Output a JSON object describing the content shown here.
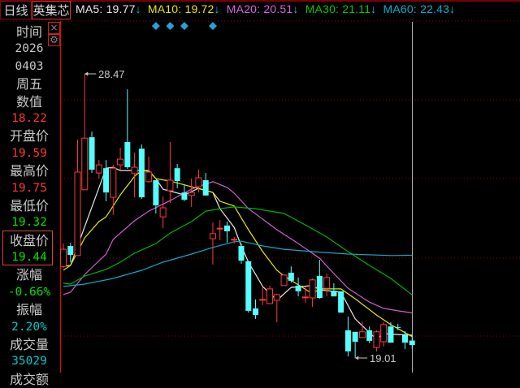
{
  "header": {
    "period": "日线",
    "stock_name": "英集芯",
    "ma_items": [
      {
        "label": "MA5: 19.77",
        "arrow": "↓",
        "color": "#e8e8e8"
      },
      {
        "label": "MA10: 19.72",
        "arrow": "↓",
        "color": "#e8e800"
      },
      {
        "label": "MA20: 20.51",
        "arrow": "↓",
        "color": "#e060e0"
      },
      {
        "label": "MA30: 21.11",
        "arrow": "↓",
        "color": "#00c800"
      },
      {
        "label": "MA60: 22.43",
        "arrow": "↓",
        "color": "#00b0d0"
      }
    ]
  },
  "tools": {
    "close_icon": "×",
    "settings_icon": "⚙"
  },
  "info_panel": {
    "time_label": "时间",
    "year": "2026",
    "date": "0403",
    "weekday": "周五",
    "value_label": "数值",
    "value": "18.22",
    "open_label": "开盘价",
    "open": "19.59",
    "high_label": "最高价",
    "high": "19.75",
    "low_label": "最低价",
    "low": "19.32",
    "close_label": "收盘价",
    "close": "19.44",
    "change_label": "涨幅",
    "change": "-0.66%",
    "amplitude_label": "振幅",
    "amplitude": "2.20%",
    "volume_label": "成交量",
    "volume": "35029",
    "amount_label": "成交额"
  },
  "chart_data": {
    "type": "candlestick",
    "title": "英集芯 日线",
    "max_label": "28.47",
    "min_label": "19.01",
    "colors": {
      "up": "#ff3a3a",
      "down": "#54ffff",
      "grid": "#8a0000"
    },
    "candles": [
      [
        22.06,
        22.82,
        22.01,
        22.63
      ],
      [
        22.74,
        22.85,
        22.2,
        22.44
      ],
      [
        22.42,
        26.28,
        22.42,
        25.2
      ],
      [
        24.61,
        28.47,
        24.61,
        26.33
      ],
      [
        26.36,
        26.55,
        25.17,
        25.28
      ],
      [
        25.17,
        25.6,
        24.98,
        25.44
      ],
      [
        25.33,
        25.6,
        24.23,
        24.52
      ],
      [
        24.36,
        25.44,
        23.77,
        25.33
      ],
      [
        25.44,
        26.01,
        25.25,
        25.63
      ],
      [
        26.2,
        27.96,
        25.31,
        25.36
      ],
      [
        25.15,
        25.85,
        24.36,
        25.36
      ],
      [
        25.98,
        26.12,
        24.31,
        24.36
      ],
      [
        24.88,
        25.71,
        24.85,
        25.2
      ],
      [
        24.93,
        24.93,
        23.82,
        24.09
      ],
      [
        23.71,
        24.39,
        23.33,
        24.01
      ],
      [
        24.58,
        26.2,
        24.17,
        24.93
      ],
      [
        25.33,
        25.47,
        24.66,
        24.9
      ],
      [
        24.52,
        24.79,
        24.23,
        24.28
      ],
      [
        24.42,
        24.98,
        24.04,
        24.52
      ],
      [
        24.71,
        25.28,
        24.52,
        25.01
      ],
      [
        24.93,
        25.17,
        24.42,
        24.42
      ],
      [
        22.98,
        23.52,
        22.12,
        23.15
      ],
      [
        23.31,
        23.6,
        22.93,
        23.33
      ],
      [
        23.42,
        23.55,
        22.85,
        23.23
      ],
      [
        22.95,
        23.04,
        22.82,
        22.96
      ],
      [
        22.74,
        22.82,
        22.15,
        22.25
      ],
      [
        22.23,
        22.23,
        20.52,
        20.58
      ],
      [
        20.66,
        20.96,
        20.31,
        20.44
      ],
      [
        20.95,
        21.39,
        20.77,
        20.96
      ],
      [
        20.82,
        21.42,
        20.82,
        21.31
      ],
      [
        20.93,
        21.15,
        20.2,
        21.12
      ],
      [
        21.42,
        21.79,
        21.42,
        21.77
      ],
      [
        21.85,
        22.06,
        21.52,
        21.58
      ],
      [
        21.42,
        21.69,
        21.06,
        21.23
      ],
      [
        21.03,
        21.39,
        20.85,
        21.04
      ],
      [
        21.01,
        21.66,
        20.71,
        21.61
      ],
      [
        21.74,
        22.28,
        20.98,
        21.01
      ],
      [
        21.33,
        21.82,
        21.06,
        21.69
      ],
      [
        21.25,
        21.5,
        21.06,
        21.06
      ],
      [
        21.23,
        21.23,
        20.52,
        20.52
      ],
      [
        19.93,
        20.39,
        19.06,
        19.23
      ],
      [
        19.88,
        19.88,
        19.01,
        19.55
      ],
      [
        19.69,
        20.23,
        19.69,
        19.88
      ],
      [
        19.93,
        20.06,
        19.5,
        19.58
      ],
      [
        19.36,
        19.93,
        19.23,
        19.88
      ],
      [
        19.55,
        20.2,
        19.39,
        20.12
      ],
      [
        20.06,
        20.2,
        19.52,
        19.52
      ],
      [
        20.04,
        20.15,
        19.93,
        20.03
      ],
      [
        19.77,
        19.9,
        19.31,
        19.52
      ],
      [
        19.59,
        19.75,
        19.32,
        19.44
      ]
    ],
    "candle_fields": [
      "open",
      "high",
      "low",
      "close"
    ],
    "moving_averages": [
      {
        "name": "MA5",
        "color": "#e8e8e8",
        "points": [
          [
            1,
            22.06
          ],
          [
            2,
            22.09
          ],
          [
            7,
            25.33
          ],
          [
            8,
            25.36
          ],
          [
            9,
            25.25
          ],
          [
            13,
            25.25
          ],
          [
            14,
            24.98
          ],
          [
            15,
            24.63
          ],
          [
            18,
            24.44
          ],
          [
            20,
            24.66
          ],
          [
            22,
            24.52
          ],
          [
            23,
            23.98
          ],
          [
            25,
            23.36
          ],
          [
            26,
            22.74
          ],
          [
            27,
            22.2
          ],
          [
            29,
            21.39
          ],
          [
            31,
            20.93
          ],
          [
            33,
            21.36
          ],
          [
            36,
            21.42
          ],
          [
            37,
            21.28
          ],
          [
            40,
            21.2
          ],
          [
            42,
            20.31
          ],
          [
            45,
            19.63
          ],
          [
            46,
            19.82
          ],
          [
            48,
            19.79
          ],
          [
            50,
            19.77
          ]
        ]
      },
      {
        "name": "MA10",
        "color": "#e8e800",
        "points": [
          [
            1,
            21.93
          ],
          [
            2,
            22.09
          ],
          [
            4,
            23.01
          ],
          [
            6,
            23.55
          ],
          [
            7,
            23.71
          ],
          [
            9,
            24.44
          ],
          [
            11,
            25.06
          ],
          [
            12,
            25.25
          ],
          [
            13,
            25.23
          ],
          [
            14,
            24.98
          ],
          [
            16,
            24.9
          ],
          [
            19,
            24.71
          ],
          [
            22,
            24.52
          ],
          [
            23,
            24.23
          ],
          [
            25,
            24.07
          ],
          [
            27,
            23.28
          ],
          [
            29,
            22.55
          ],
          [
            31,
            21.93
          ],
          [
            32,
            21.74
          ],
          [
            36,
            21.15
          ],
          [
            37,
            21.31
          ],
          [
            40,
            21.31
          ],
          [
            42,
            20.98
          ],
          [
            45,
            20.44
          ],
          [
            47,
            20.12
          ],
          [
            50,
            19.72
          ]
        ]
      },
      {
        "name": "MA20",
        "color": "#d060d0",
        "points": [
          [
            1,
            21.12
          ],
          [
            2,
            21.2
          ],
          [
            4,
            21.79
          ],
          [
            7,
            22.47
          ],
          [
            8,
            22.96
          ],
          [
            11,
            23.58
          ],
          [
            13,
            23.9
          ],
          [
            16,
            24.25
          ],
          [
            19,
            24.63
          ],
          [
            22,
            24.88
          ],
          [
            24,
            24.69
          ],
          [
            25,
            24.5
          ],
          [
            27,
            23.98
          ],
          [
            31,
            23.28
          ],
          [
            34,
            22.82
          ],
          [
            37,
            22.33
          ],
          [
            39,
            21.82
          ],
          [
            41,
            21.33
          ],
          [
            44,
            20.87
          ],
          [
            46,
            20.66
          ],
          [
            48,
            20.58
          ],
          [
            50,
            20.51
          ]
        ]
      },
      {
        "name": "MA30",
        "color": "#00b400",
        "points": [
          [
            1,
            21.5
          ],
          [
            2,
            21.47
          ],
          [
            4,
            21.74
          ],
          [
            7,
            21.96
          ],
          [
            9,
            22.2
          ],
          [
            11,
            22.5
          ],
          [
            14,
            22.82
          ],
          [
            16,
            23.17
          ],
          [
            19,
            23.55
          ],
          [
            21,
            23.9
          ],
          [
            23,
            23.98
          ],
          [
            25,
            24.04
          ],
          [
            28,
            23.98
          ],
          [
            32,
            23.82
          ],
          [
            35,
            23.44
          ],
          [
            38,
            23.04
          ],
          [
            41,
            22.55
          ],
          [
            44,
            22.09
          ],
          [
            47,
            21.66
          ],
          [
            50,
            21.11
          ]
        ]
      },
      {
        "name": "MA60",
        "color": "#10a8c8",
        "points": [
          [
            1,
            21.39
          ],
          [
            4,
            21.47
          ],
          [
            8,
            21.66
          ],
          [
            12,
            21.93
          ],
          [
            15,
            22.2
          ],
          [
            19,
            22.47
          ],
          [
            22,
            22.69
          ],
          [
            25,
            22.88
          ],
          [
            26,
            22.9
          ],
          [
            29,
            22.74
          ],
          [
            32,
            22.63
          ],
          [
            36,
            22.55
          ],
          [
            41,
            22.47
          ],
          [
            47,
            22.42
          ],
          [
            50,
            22.43
          ]
        ]
      }
    ],
    "signal_markers": [
      14,
      16,
      18,
      22
    ]
  }
}
